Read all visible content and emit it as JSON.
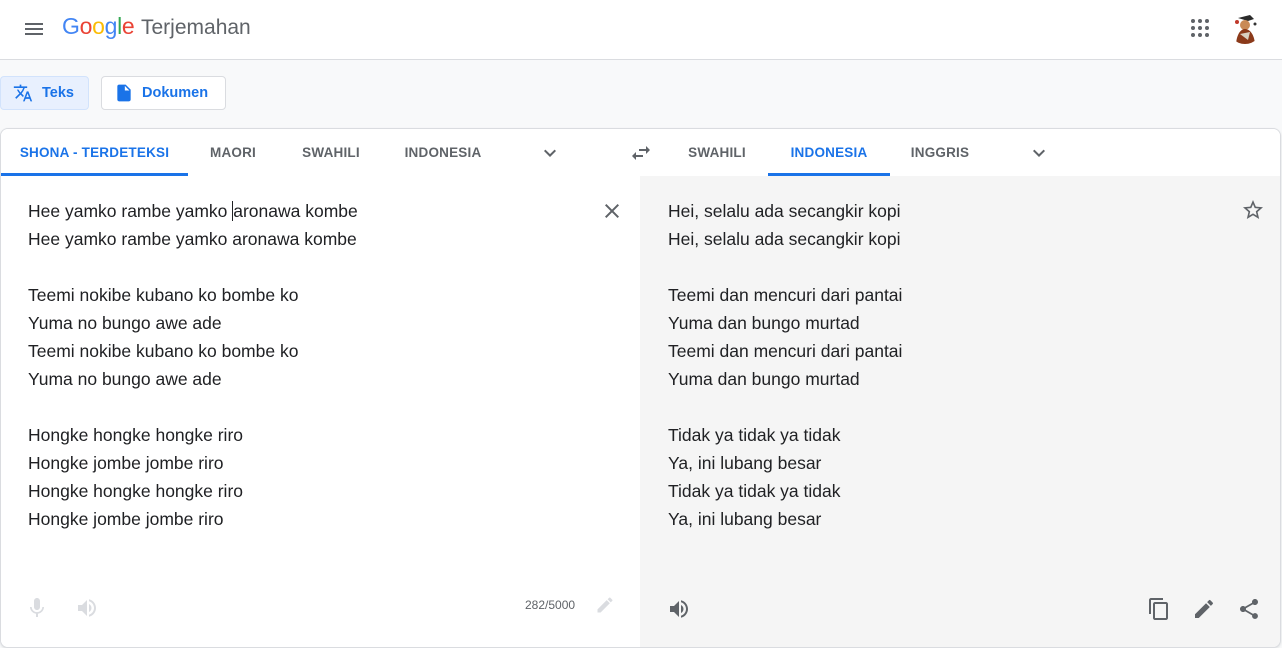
{
  "header": {
    "logo_letters": [
      {
        "ch": "G",
        "color": "#4285f4"
      },
      {
        "ch": "o",
        "color": "#ea4335"
      },
      {
        "ch": "o",
        "color": "#fbbc05"
      },
      {
        "ch": "g",
        "color": "#4285f4"
      },
      {
        "ch": "l",
        "color": "#34a853"
      },
      {
        "ch": "e",
        "color": "#ea4335"
      }
    ],
    "product": "Terjemahan",
    "icons": {
      "menu": "hamburger-icon",
      "apps": "apps-grid-icon",
      "avatar": "user-avatar"
    }
  },
  "modes": {
    "text_label": "Teks",
    "document_label": "Dokumen"
  },
  "source_langs": {
    "detected": "SHONA - TERDETEKSI",
    "lang1": "MAORI",
    "lang2": "SWAHILI",
    "lang3": "INDONESIA"
  },
  "target_langs": {
    "lang1": "SWAHILI",
    "lang2": "INDONESIA",
    "lang3": "INGGRIS"
  },
  "source_text": {
    "line1_a": "Hee yamko rambe yamko ",
    "line1_b": "aronawa kombe",
    "lines": [
      "Hee yamko rambe yamko aronawa kombe",
      "",
      "Teemi nokibe kubano ko bombe ko",
      "Yuma no bungo awe ade",
      "Teemi nokibe kubano ko bombe ko",
      "Yuma no bungo awe ade",
      "",
      "Hongke hongke hongke riro",
      "Hongke jombe jombe riro",
      "Hongke hongke hongke riro",
      "Hongke jombe jombe riro"
    ],
    "char_count": "282/5000"
  },
  "translated_text": {
    "lines": [
      "Hei, selalu ada secangkir kopi",
      "Hei, selalu ada secangkir kopi",
      "",
      "Teemi dan mencuri dari pantai",
      "Yuma dan bungo murtad",
      "Teemi dan mencuri dari pantai",
      "Yuma dan bungo murtad",
      "",
      "Tidak ya tidak ya tidak",
      "Ya, ini lubang besar",
      "Tidak ya tidak ya tidak",
      "Ya, ini lubang besar"
    ]
  },
  "colors": {
    "accent": "#1a73e8",
    "muted": "#5f6368",
    "target_bg": "#f5f5f5"
  }
}
